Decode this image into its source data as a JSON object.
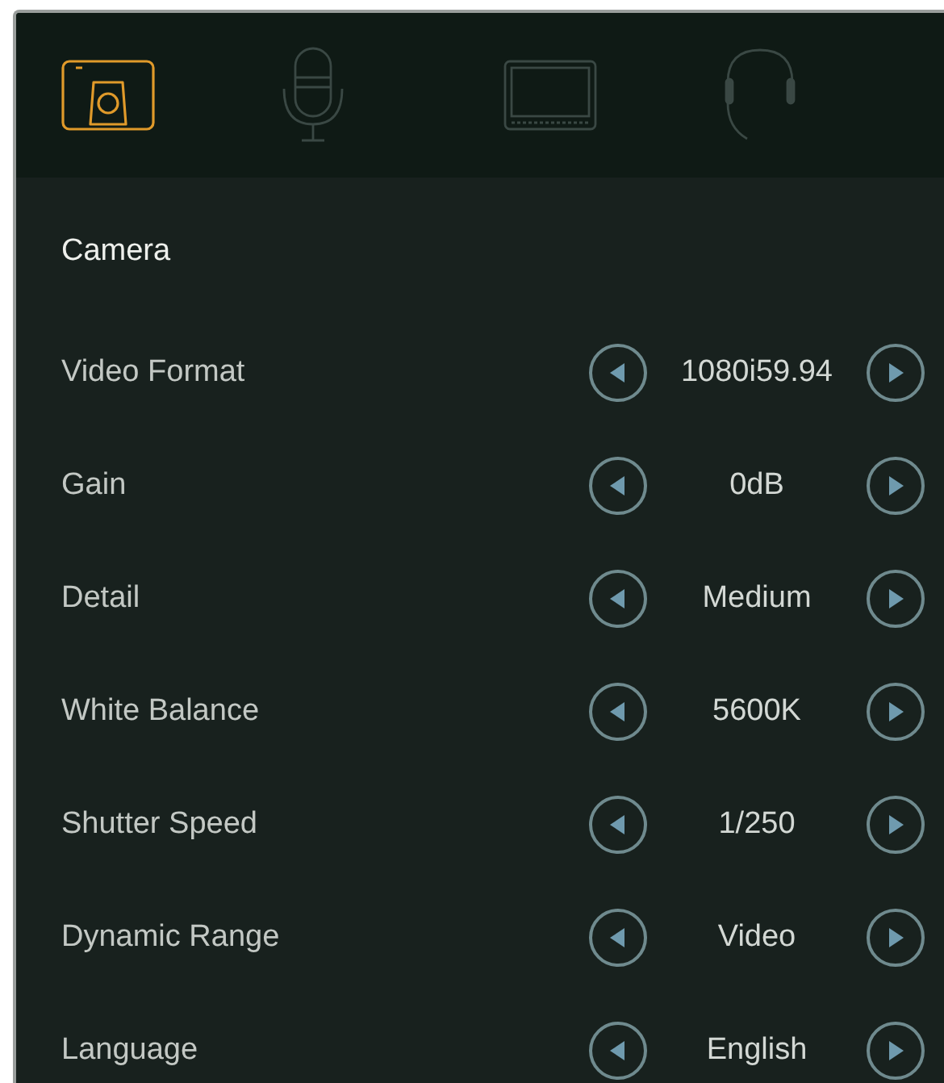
{
  "tabs": [
    {
      "kind": "camera",
      "selected": true
    },
    {
      "kind": "microphone",
      "selected": false
    },
    {
      "kind": "monitor",
      "selected": false
    },
    {
      "kind": "headset",
      "selected": false
    }
  ],
  "section_title": "Camera",
  "settings": [
    {
      "label": "Video Format",
      "value": "1080i59.94"
    },
    {
      "label": "Gain",
      "value": "0dB"
    },
    {
      "label": "Detail",
      "value": "Medium"
    },
    {
      "label": "White Balance",
      "value": "5600K"
    },
    {
      "label": "Shutter Speed",
      "value": "1/250"
    },
    {
      "label": "Dynamic Range",
      "value": "Video"
    },
    {
      "label": "Language",
      "value": "English"
    }
  ]
}
